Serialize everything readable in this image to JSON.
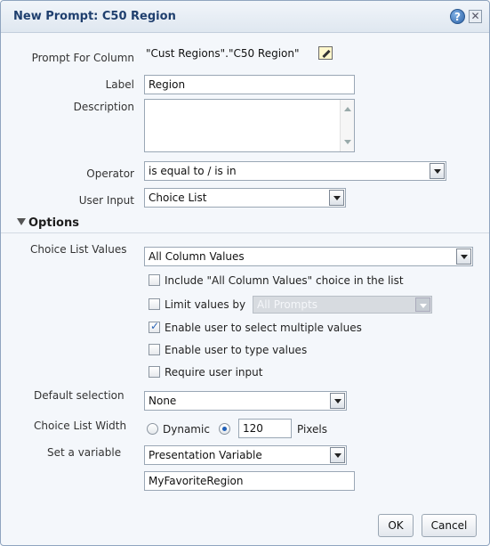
{
  "dialog": {
    "title": "New Prompt: C50 Region",
    "help_icon": "?",
    "close_icon": "✕"
  },
  "fields": {
    "prompt_for_column_label": "Prompt For Column",
    "prompt_for_column_value": "\"Cust Regions\".\"C50 Region\"",
    "label_label": "Label",
    "label_value": "Region",
    "description_label": "Description",
    "description_value": "",
    "operator_label": "Operator",
    "operator_value": "is equal to / is in",
    "user_input_label": "User Input",
    "user_input_value": "Choice List"
  },
  "options": {
    "section_title": "Options",
    "choice_list_values_label": "Choice List Values",
    "choice_list_values_value": "All Column Values",
    "checkboxes": [
      {
        "label": "Include \"All Column Values\" choice in the list",
        "checked": false
      },
      {
        "label": "Limit values by",
        "checked": false
      },
      {
        "label": "Enable user to select multiple values",
        "checked": true
      },
      {
        "label": "Enable user to type values",
        "checked": false
      },
      {
        "label": "Require user input",
        "checked": false
      }
    ],
    "limit_values_by_value": "All Prompts",
    "default_selection_label": "Default selection",
    "default_selection_value": "None",
    "choice_list_width_label": "Choice List Width",
    "dynamic_label": "Dynamic",
    "width_value": "120",
    "pixels_label": "Pixels",
    "set_variable_label": "Set a variable",
    "set_variable_value": "Presentation Variable",
    "variable_name_value": "MyFavoriteRegion"
  },
  "buttons": {
    "ok": "OK",
    "cancel": "Cancel"
  },
  "icons": {
    "help": "help-icon",
    "close": "close-icon",
    "edit": "edit-icon",
    "options_toggle": "chevron-down-icon"
  },
  "colors": {
    "title_text": "#1f3f6e",
    "dialog_background": "#f4f7fb",
    "checkbox_check": "#2a64b5"
  }
}
